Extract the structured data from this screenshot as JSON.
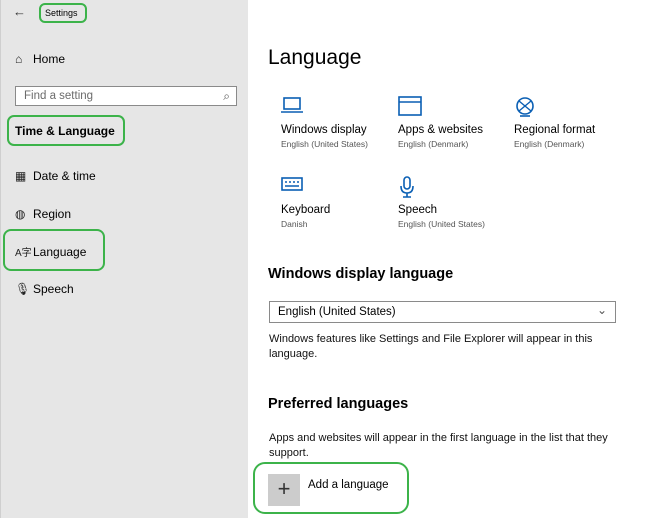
{
  "window": {
    "back_glyph": "←",
    "title": "Settings"
  },
  "sidebar": {
    "home_label": "Home",
    "search_placeholder": "Find a setting",
    "section_title": "Time & Language",
    "items": [
      {
        "label": "Date & time",
        "icon": "calendar-clock-icon"
      },
      {
        "label": "Region",
        "icon": "globe-icon"
      },
      {
        "label": "Language",
        "icon": "language-icon"
      },
      {
        "label": "Speech",
        "icon": "microphone-icon"
      }
    ]
  },
  "main": {
    "title": "Language",
    "tiles": [
      {
        "name": "Windows display",
        "sub": "English (United States)",
        "icon": "laptop-icon"
      },
      {
        "name": "Apps & websites",
        "sub": "English (Denmark)",
        "icon": "window-icon"
      },
      {
        "name": "Regional format",
        "sub": "English (Denmark)",
        "icon": "regional-format-icon"
      },
      {
        "name": "Keyboard",
        "sub": "Danish",
        "icon": "keyboard-icon"
      },
      {
        "name": "Speech",
        "sub": "English (United States)",
        "icon": "microphone-icon"
      }
    ],
    "display_language": {
      "heading": "Windows display language",
      "selected": "English (United States)",
      "description": "Windows features like Settings and File Explorer will appear in this language."
    },
    "preferred": {
      "heading": "Preferred languages",
      "description": "Apps and websites will appear in the first language in the list that they support.",
      "add_label": "Add a language"
    }
  },
  "colors": {
    "highlight": "#3cb34a",
    "accent": "#0a5fb4",
    "sidebar_bg": "#e6e6e6"
  }
}
